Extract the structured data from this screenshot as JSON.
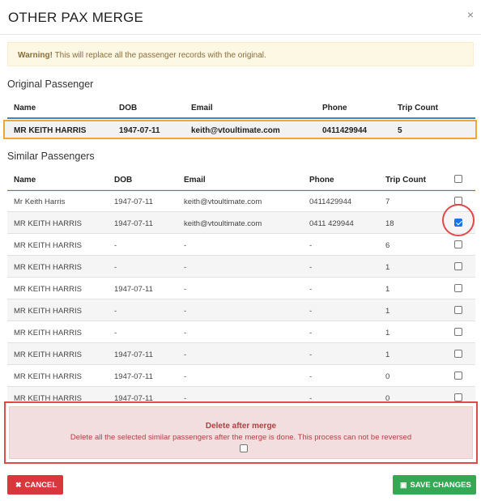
{
  "dialog": {
    "title": "OTHER PAX MERGE",
    "close_glyph": "×"
  },
  "warning": {
    "strong": "Warning!",
    "text": " This will replace all the passenger records with the original."
  },
  "original": {
    "section_label": "Original Passenger",
    "columns": [
      "Name",
      "DOB",
      "Email",
      "Phone",
      "Trip Count"
    ],
    "row": {
      "name": "MR KEITH HARRIS",
      "dob": "1947-07-11",
      "email": "keith@vtoultimate.com",
      "phone": "0411429944",
      "trips": "5"
    }
  },
  "similar": {
    "section_label": "Similar Passengers",
    "columns": [
      "Name",
      "DOB",
      "Email",
      "Phone",
      "Trip Count"
    ],
    "rows": [
      {
        "name": "Mr Keith Harris",
        "dob": "1947-07-11",
        "email": "keith@vtoultimate.com",
        "phone": "0411429944",
        "trips": "7",
        "checked": false
      },
      {
        "name": "MR KEITH HARRIS",
        "dob": "1947-07-11",
        "email": "keith@vtoultimate.com",
        "phone": "0411 429944",
        "trips": "18",
        "checked": true
      },
      {
        "name": "MR KEITH HARRIS",
        "dob": "-",
        "email": "-",
        "phone": "-",
        "trips": "6",
        "checked": false
      },
      {
        "name": "MR KEITH HARRIS",
        "dob": "-",
        "email": "-",
        "phone": "-",
        "trips": "1",
        "checked": false
      },
      {
        "name": "MR KEITH HARRIS",
        "dob": "1947-07-11",
        "email": "-",
        "phone": "-",
        "trips": "1",
        "checked": false
      },
      {
        "name": "MR KEITH HARRIS",
        "dob": "-",
        "email": "-",
        "phone": "-",
        "trips": "1",
        "checked": false
      },
      {
        "name": "MR KEITH HARRIS",
        "dob": "-",
        "email": "-",
        "phone": "-",
        "trips": "1",
        "checked": false
      },
      {
        "name": "MR KEITH HARRIS",
        "dob": "1947-07-11",
        "email": "-",
        "phone": "-",
        "trips": "1",
        "checked": false
      },
      {
        "name": "MR KEITH HARRIS",
        "dob": "1947-07-11",
        "email": "-",
        "phone": "-",
        "trips": "0",
        "checked": false
      },
      {
        "name": "MR KEITH HARRIS",
        "dob": "1947-07-11",
        "email": "-",
        "phone": "-",
        "trips": "0",
        "checked": false
      }
    ]
  },
  "delete_after_merge": {
    "title": "Delete after merge",
    "description": "Delete all the selected similar passengers after the merge is done. This process can not be reversed",
    "checked": false
  },
  "buttons": {
    "cancel": {
      "icon": "close-icon",
      "glyph": "✖",
      "label": "CANCEL",
      "color": "#d9373c"
    },
    "save": {
      "icon": "save-icon",
      "glyph": "▣",
      "label": "SAVE CHANGES",
      "color": "#34a853"
    }
  }
}
